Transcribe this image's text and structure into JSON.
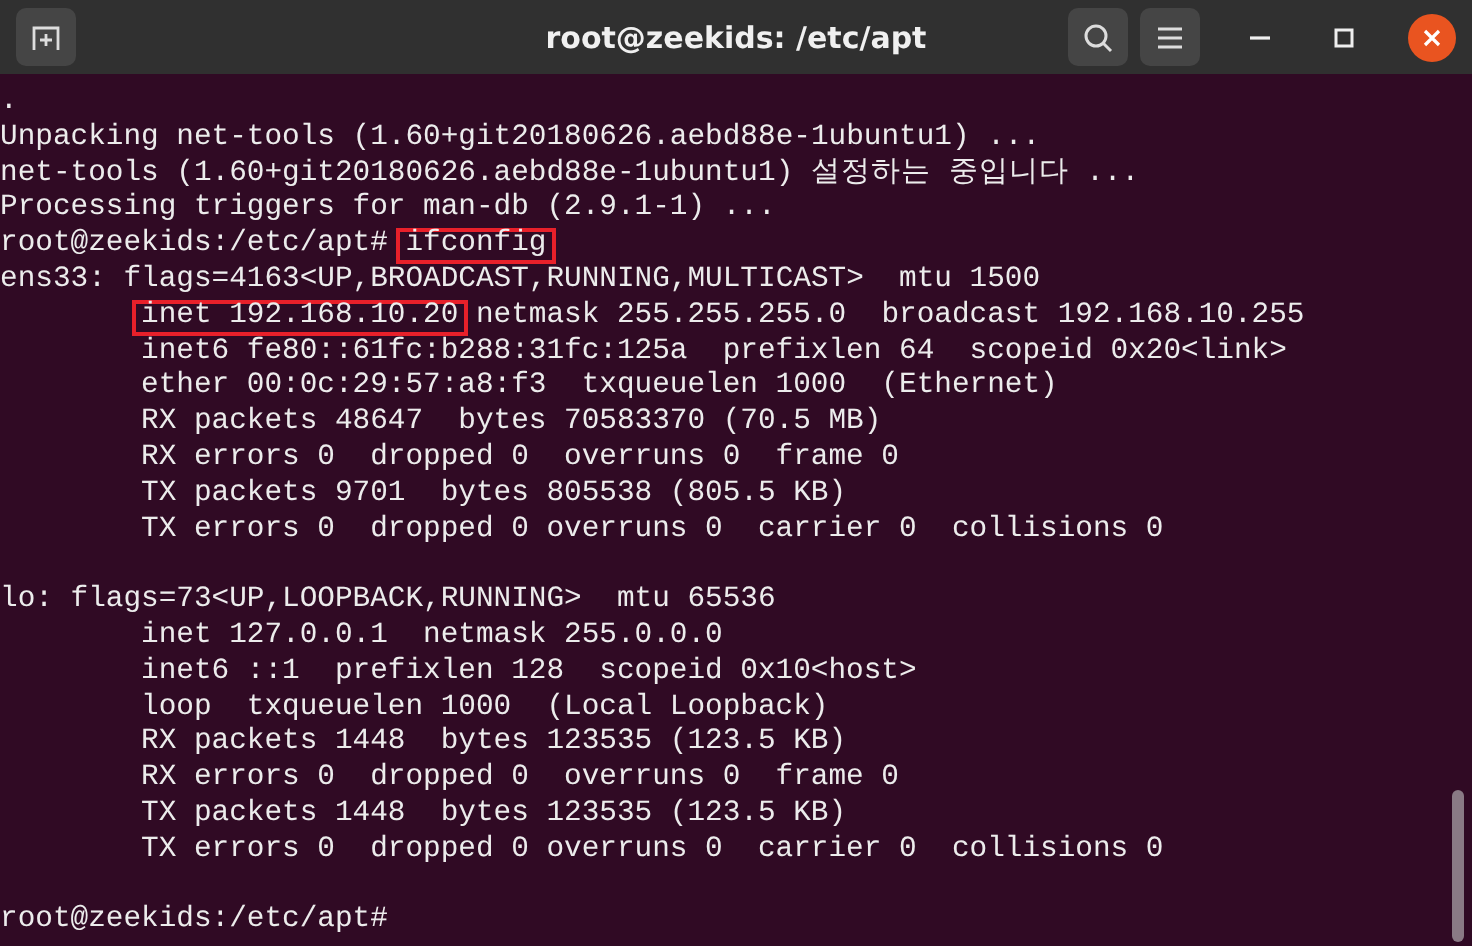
{
  "window": {
    "title": "root@zeekids: /etc/apt"
  },
  "terminal": {
    "lines": [
      {
        "indented": false,
        "gap_before": false,
        "parts": [
          {
            "text": ".",
            "boxed": false
          }
        ]
      },
      {
        "indented": false,
        "gap_before": false,
        "parts": [
          {
            "text": "Unpacking net-tools (1.60+git20180626.aebd88e-1ubuntu1) ...",
            "boxed": false
          }
        ]
      },
      {
        "indented": false,
        "gap_before": false,
        "parts": [
          {
            "text": "net-tools (1.60+git20180626.aebd88e-1ubuntu1) 설정하는 중입니다 ...",
            "boxed": false
          }
        ]
      },
      {
        "indented": false,
        "gap_before": false,
        "parts": [
          {
            "text": "Processing triggers for man-db (2.9.1-1) ...",
            "boxed": false
          }
        ]
      },
      {
        "indented": false,
        "gap_before": false,
        "parts": [
          {
            "text": "root@zeekids:/etc/apt#",
            "boxed": false
          },
          {
            "text": "ifconfig",
            "boxed": true
          }
        ]
      },
      {
        "indented": false,
        "gap_before": false,
        "parts": [
          {
            "text": "ens33: flags=4163<UP,BROADCAST,RUNNING,MULTICAST>  mtu 1500",
            "boxed": false
          }
        ]
      },
      {
        "indented": true,
        "gap_before": false,
        "parts": [
          {
            "text": "inet 192.168.10.20",
            "boxed": true
          },
          {
            "text": "netmask 255.255.255.0  broadcast 192.168.10.255",
            "boxed": false
          }
        ]
      },
      {
        "indented": true,
        "gap_before": false,
        "parts": [
          {
            "text": "inet6 fe80::61fc:b288:31fc:125a  prefixlen 64  scopeid 0x20<link>",
            "boxed": false
          }
        ]
      },
      {
        "indented": true,
        "gap_before": false,
        "parts": [
          {
            "text": "ether 00:0c:29:57:a8:f3  txqueuelen 1000  (Ethernet)",
            "boxed": false
          }
        ]
      },
      {
        "indented": true,
        "gap_before": false,
        "parts": [
          {
            "text": "RX packets 48647  bytes 70583370 (70.5 MB)",
            "boxed": false
          }
        ]
      },
      {
        "indented": true,
        "gap_before": false,
        "parts": [
          {
            "text": "RX errors 0  dropped 0  overruns 0  frame 0",
            "boxed": false
          }
        ]
      },
      {
        "indented": true,
        "gap_before": false,
        "parts": [
          {
            "text": "TX packets 9701  bytes 805538 (805.5 KB)",
            "boxed": false
          }
        ]
      },
      {
        "indented": true,
        "gap_before": false,
        "parts": [
          {
            "text": "TX errors 0  dropped 0 overruns 0  carrier 0  collisions 0",
            "boxed": false
          }
        ]
      },
      {
        "indented": false,
        "gap_before": true,
        "parts": [
          {
            "text": "lo: flags=73<UP,LOOPBACK,RUNNING>  mtu 65536",
            "boxed": false
          }
        ]
      },
      {
        "indented": true,
        "gap_before": false,
        "parts": [
          {
            "text": "inet 127.0.0.1  netmask 255.0.0.0",
            "boxed": false
          }
        ]
      },
      {
        "indented": true,
        "gap_before": false,
        "parts": [
          {
            "text": "inet6 ::1  prefixlen 128  scopeid 0x10<host>",
            "boxed": false
          }
        ]
      },
      {
        "indented": true,
        "gap_before": false,
        "parts": [
          {
            "text": "loop  txqueuelen 1000  (Local Loopback)",
            "boxed": false
          }
        ]
      },
      {
        "indented": true,
        "gap_before": false,
        "parts": [
          {
            "text": "RX packets 1448  bytes 123535 (123.5 KB)",
            "boxed": false
          }
        ]
      },
      {
        "indented": true,
        "gap_before": false,
        "parts": [
          {
            "text": "RX errors 0  dropped 0  overruns 0  frame 0",
            "boxed": false
          }
        ]
      },
      {
        "indented": true,
        "gap_before": false,
        "parts": [
          {
            "text": "TX packets 1448  bytes 123535 (123.5 KB)",
            "boxed": false
          }
        ]
      },
      {
        "indented": true,
        "gap_before": false,
        "parts": [
          {
            "text": "TX errors 0  dropped 0 overruns 0  carrier 0  collisions 0",
            "boxed": false
          }
        ]
      },
      {
        "indented": false,
        "gap_before": true,
        "parts": [
          {
            "text": "root@zeekids:/etc/apt#",
            "boxed": false
          }
        ]
      }
    ]
  }
}
